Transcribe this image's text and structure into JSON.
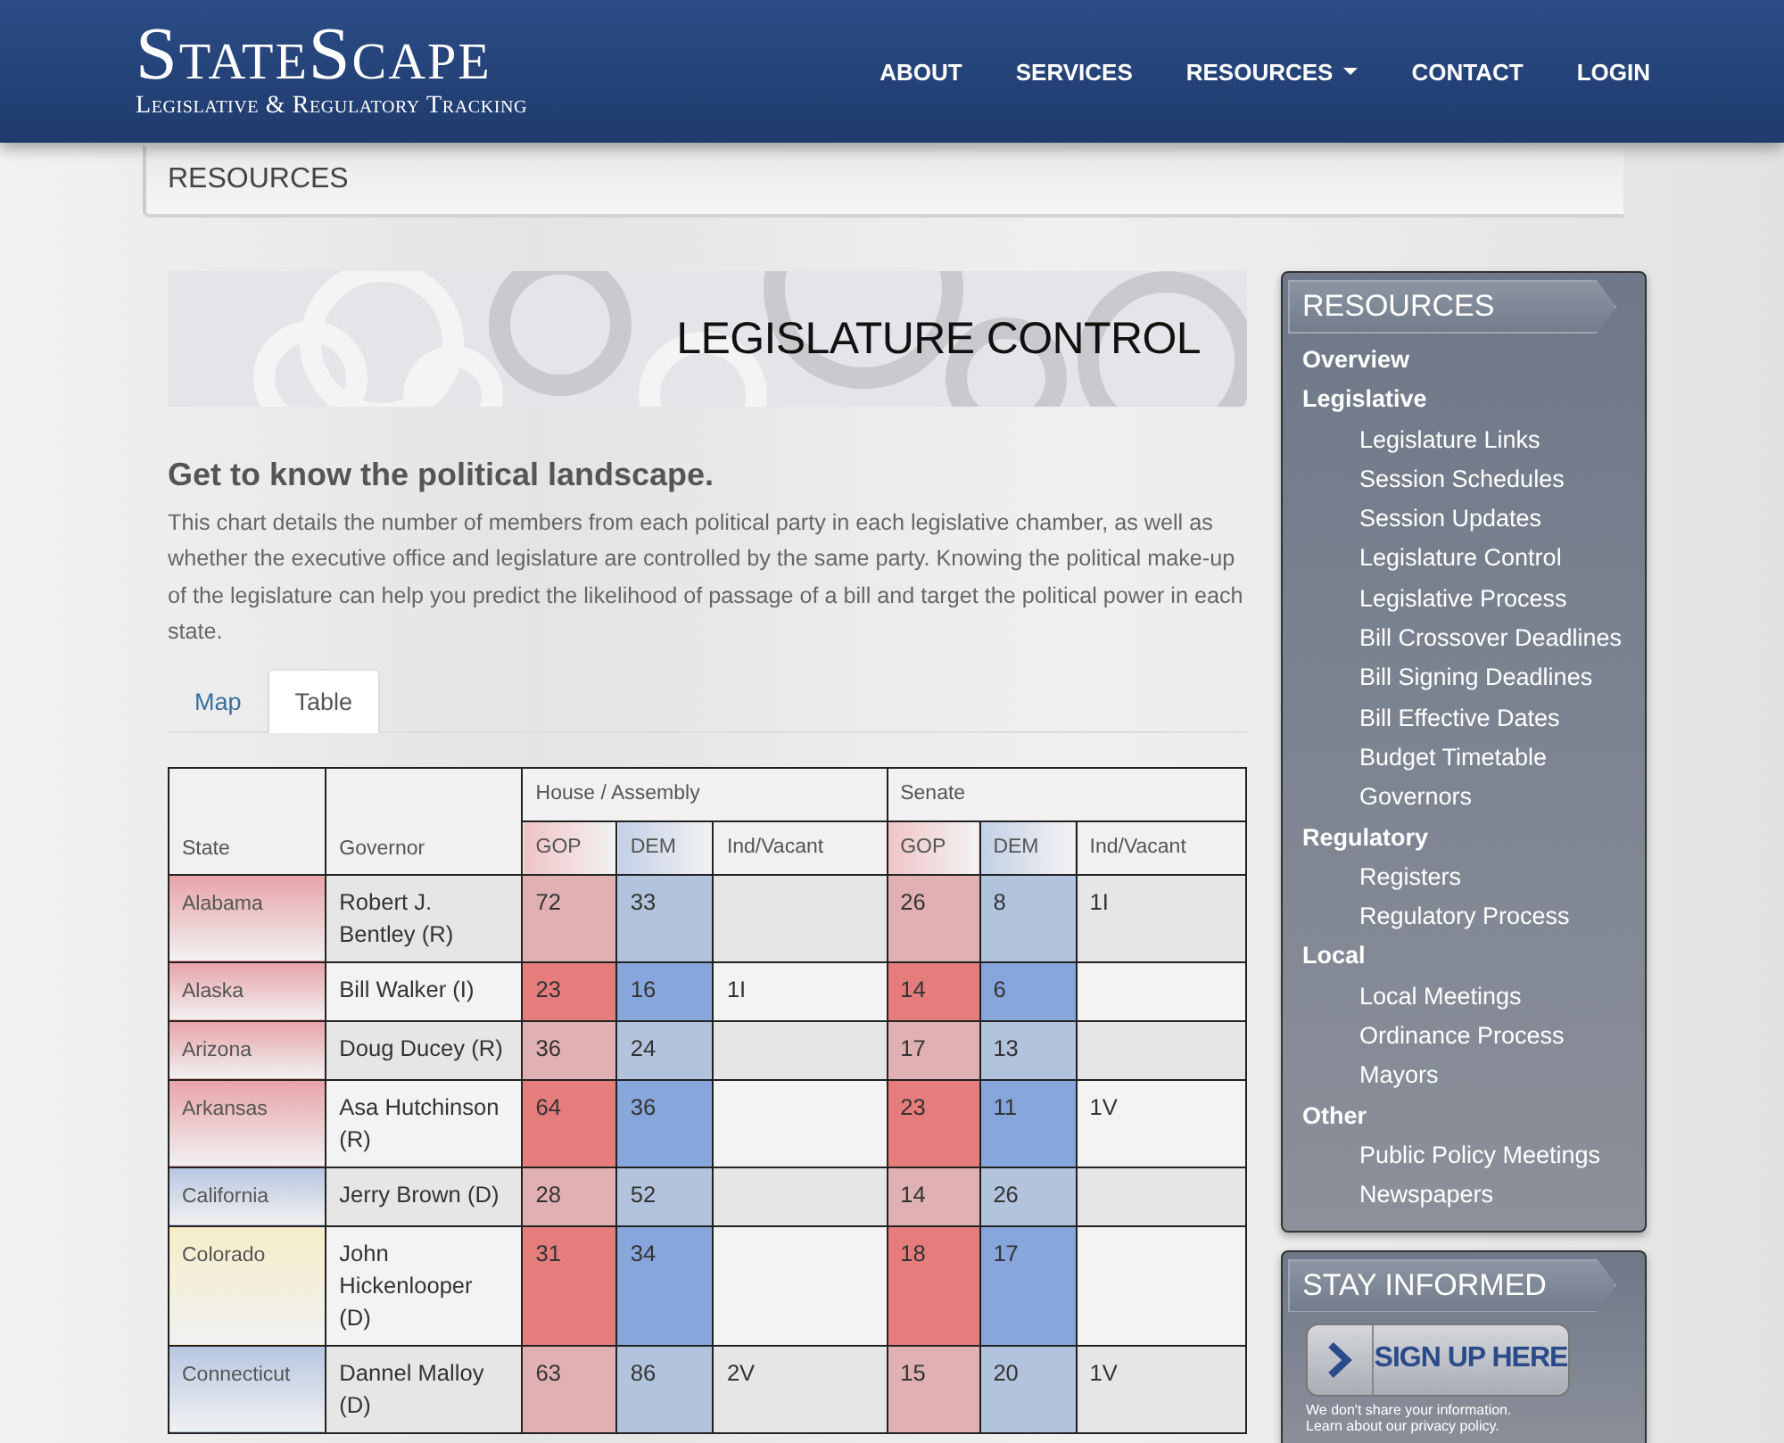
{
  "header": {
    "logo_title": "StateScape",
    "logo_subtitle": "Legislative & Regulatory Tracking",
    "nav": [
      {
        "label": "ABOUT",
        "dropdown": false
      },
      {
        "label": "SERVICES",
        "dropdown": false
      },
      {
        "label": "RESOURCES",
        "dropdown": true
      },
      {
        "label": "CONTACT",
        "dropdown": false
      },
      {
        "label": "LOGIN",
        "dropdown": false
      }
    ]
  },
  "breadcrumb": "RESOURCES",
  "banner": {
    "title": "LEGISLATURE CONTROL"
  },
  "heading": "Get to know the political landscape.",
  "intro": "This chart details the number of members from each political party in each legislative chamber, as well as whether the executive office and legislature are controlled by the same party.  Knowing the political make-up of the legislature can help you predict the likelihood of passage of a bill and target the political power in each state.",
  "tabs": [
    {
      "label": "Map",
      "selected": false
    },
    {
      "label": "Table",
      "selected": true
    }
  ],
  "table": {
    "state_header": "State",
    "governor_header": "Governor",
    "groups": [
      {
        "label": "House / Assembly",
        "columns": [
          "GOP",
          "DEM",
          "Ind/Vacant"
        ]
      },
      {
        "label": "Senate",
        "columns": [
          "GOP",
          "DEM",
          "Ind/Vacant"
        ]
      }
    ],
    "rows": [
      {
        "state": "Alabama",
        "color": "#e8a3a8",
        "governor": "Robert J. Bentley (R)",
        "highlight": false,
        "house": {
          "gop": "72",
          "dem": "33"
        },
        "senate": {
          "gop": "26",
          "dem": "8",
          "ind": "1I"
        }
      },
      {
        "state": "Alaska",
        "color": "#e8a3a8",
        "governor": "Bill Walker (I)",
        "highlight": true,
        "house": {
          "gop": "23",
          "dem": "16",
          "ind": "1I"
        },
        "senate": {
          "gop": "14",
          "dem": "6"
        }
      },
      {
        "state": "Arizona",
        "color": "#e8a3a8",
        "governor": "Doug Ducey (R)",
        "highlight": false,
        "house": {
          "gop": "36",
          "dem": "24"
        },
        "senate": {
          "gop": "17",
          "dem": "13"
        }
      },
      {
        "state": "Arkansas",
        "color": "#e8a3a8",
        "governor": "Asa Hutchinson (R)",
        "highlight": true,
        "house": {
          "gop": "64",
          "dem": "36"
        },
        "senate": {
          "gop": "23",
          "dem": "11",
          "ind": "1V"
        }
      },
      {
        "state": "California",
        "color": "#b6c6e0",
        "governor": "Jerry Brown (D)",
        "highlight": false,
        "house": {
          "gop": "28",
          "dem": "52"
        },
        "senate": {
          "gop": "14",
          "dem": "26"
        }
      },
      {
        "state": "Colorado",
        "color": "#f6eec8",
        "governor": "John Hickenlooper (D)",
        "highlight": true,
        "house": {
          "gop": "31",
          "dem": "34"
        },
        "senate": {
          "gop": "18",
          "dem": "17"
        }
      },
      {
        "state": "Connecticut",
        "color": "#b6c6e0",
        "governor": "Dannel Malloy (D)",
        "highlight": false,
        "house": {
          "gop": "63",
          "dem": "86",
          "ind": "2V"
        },
        "senate": {
          "gop": "15",
          "dem": "20",
          "ind": "1V"
        }
      }
    ]
  },
  "sidebar": {
    "title": "RESOURCES",
    "items": [
      {
        "label": "Overview"
      },
      {
        "label": "Legislative",
        "children": [
          {
            "label": "Legislature Links"
          },
          {
            "label": "Session Schedules"
          },
          {
            "label": "Session Updates"
          },
          {
            "label": "Legislature Control"
          },
          {
            "label": "Legislative Process"
          },
          {
            "label": "Bill Crossover Deadlines"
          },
          {
            "label": "Bill Signing Deadlines"
          },
          {
            "label": "Bill Effective Dates"
          },
          {
            "label": "Budget Timetable"
          },
          {
            "label": "Governors"
          }
        ]
      },
      {
        "label": "Regulatory",
        "children": [
          {
            "label": "Registers"
          },
          {
            "label": "Regulatory Process"
          }
        ]
      },
      {
        "label": "Local",
        "children": [
          {
            "label": "Local Meetings"
          },
          {
            "label": "Ordinance Process"
          },
          {
            "label": "Mayors"
          }
        ]
      },
      {
        "label": "Other",
        "children": [
          {
            "label": "Public Policy Meetings"
          },
          {
            "label": "Newspapers"
          }
        ]
      }
    ]
  },
  "stay_informed": {
    "title": "STAY INFORMED",
    "button": "SIGN UP HERE",
    "note_lines": [
      "We don't share your information.",
      "Learn about our privacy policy."
    ]
  }
}
